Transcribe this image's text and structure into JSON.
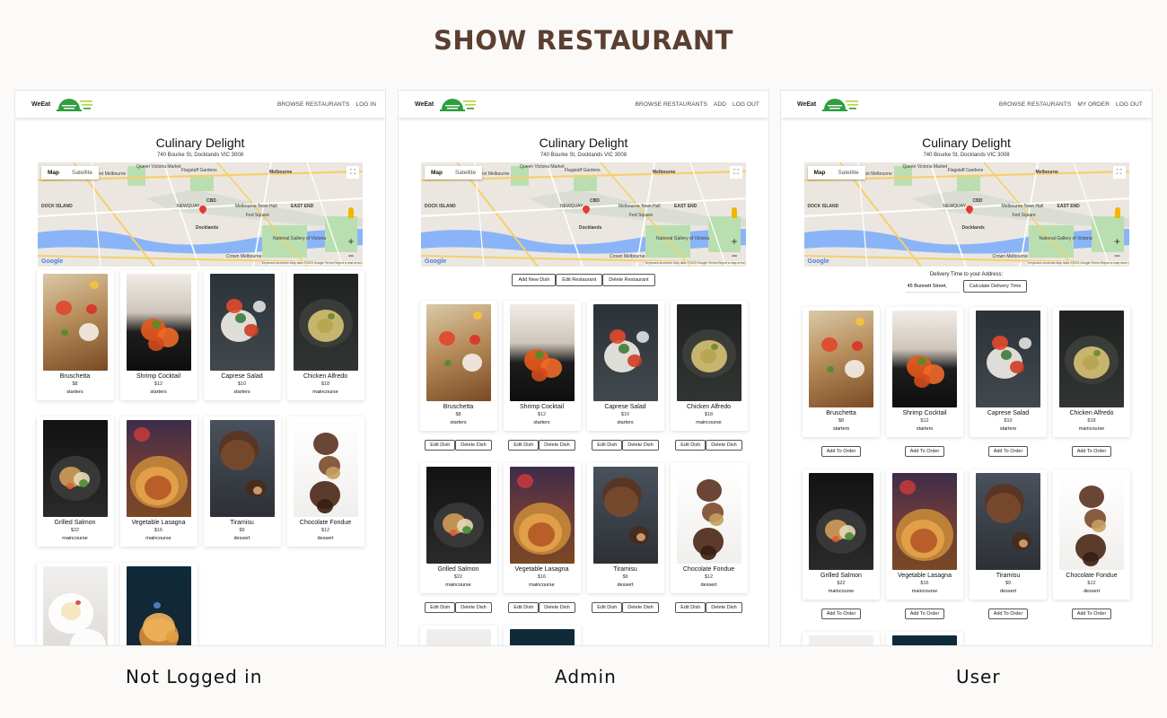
{
  "page": {
    "title": "SHOW RESTAURANT"
  },
  "screens": [
    {
      "caption": "Not Logged in",
      "nav": {
        "brand": "WeEat",
        "links": [
          "BROWSE RESTAURANTS",
          "LOG IN"
        ]
      }
    },
    {
      "caption": "Admin",
      "nav": {
        "brand": "WeEat",
        "links": [
          "BROWSE RESTAURANTS",
          "ADD",
          "LOG OUT"
        ]
      },
      "admin_actions": [
        "Add New Dish",
        "Edit Restaurant",
        "Delete Restaurant"
      ],
      "card_actions": [
        "Edit Dish",
        "Delete Dish"
      ]
    },
    {
      "caption": "User",
      "nav": {
        "brand": "WeEat",
        "links": [
          "BROWSE RESTAURANTS",
          "MY ORDER",
          "LOG OUT"
        ]
      },
      "delivery": {
        "label": "Delivery Time to your Address:",
        "value": "45 Bunnett Street,",
        "button": "Calculate Delivery Time"
      },
      "card_action": "Add To Order"
    }
  ],
  "restaurant": {
    "name": "Culinary Delight",
    "address": "740 Bourke St, Docklands VIC 3008"
  },
  "map": {
    "tabs": [
      "Map",
      "Satellite"
    ],
    "google": "Google",
    "attribution": "Keyboard shortcuts   Map data ©2023 Google   Terms   Report a map error",
    "labels": [
      "West Melbourne",
      "Queen Victoria Market",
      "Flagstaff Gardens",
      "Melbourne",
      "CBD",
      "Melbourne Town Hall",
      "EAST END",
      "Docklands",
      "DOCK ISLAND",
      "Fed Square",
      "National Gallery of Victoria",
      "Crown Melbourne",
      "NEWQUAY"
    ]
  },
  "dishes": [
    {
      "name": "Bruschetta",
      "price": "$8",
      "category": "starters"
    },
    {
      "name": "Shrimp Cocktail",
      "price": "$12",
      "category": "starters"
    },
    {
      "name": "Caprese Salad",
      "price": "$10",
      "category": "starters"
    },
    {
      "name": "Chicken Alfredo",
      "price": "$18",
      "category": "maincourse"
    },
    {
      "name": "Grilled Salmon",
      "price": "$22",
      "category": "maincourse"
    },
    {
      "name": "Vegetable Lasagna",
      "price": "$16",
      "category": "maincourse"
    },
    {
      "name": "Tiramisu",
      "price": "$9",
      "category": "dessert"
    },
    {
      "name": "Chocolate Fondue",
      "price": "$12",
      "category": "dessert"
    }
  ],
  "colors": {
    "title": "#5b3f31",
    "logo_green": "#2e9e3e",
    "logo_lime": "#b7d43a"
  }
}
